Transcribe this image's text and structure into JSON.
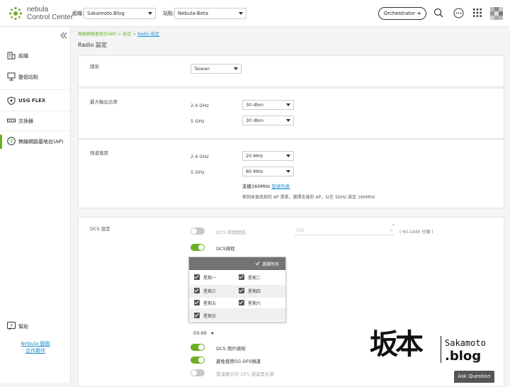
{
  "header": {
    "brand_line1": "nebula",
    "brand_line2": "Control Center",
    "org_label": "組織:",
    "org_value": "Sakamoto.Blog",
    "site_label": "站點:",
    "site_value": "Nebula-Beta",
    "orchestrator_label": "Orchestrator ➔"
  },
  "sidebar": {
    "items": [
      {
        "label": "組織"
      },
      {
        "label": "整個站點"
      },
      {
        "label": "USG FLEX"
      },
      {
        "label": "交換器"
      },
      {
        "label": "無線網路基地台(AP)"
      }
    ],
    "help": "幫助",
    "link1": "Nebula 服務",
    "link2": "合作夥伴"
  },
  "breadcrumb": {
    "part1": "無線網路基地台(AP) > 設定 > ",
    "part2": "Radio 設定"
  },
  "page_title": "Radio 設定",
  "country": {
    "label": "國家",
    "value": "Taiwan"
  },
  "power": {
    "label": "最大輸出功率",
    "band24": "2.4 GHz",
    "band24_value": "30 dbm",
    "band5": "5 GHz",
    "band5_value": "30 dbm"
  },
  "bandwidth": {
    "label": "頻道寬度",
    "band24": "2.4 GHz",
    "band24_value": "20 MHz",
    "band5": "5 GHz",
    "band5_value": "80 MHz",
    "support_text": "支援160MHz ",
    "support_link": "型號列表",
    "note": "移到本頁底部的 AP 清單，選擇支援的 AP，以在 5GHz 設定 160MHz"
  },
  "dcs": {
    "label": "DCS 設定",
    "interval_label": "DCS 時間間隔",
    "interval_value": "720",
    "interval_range": "( 60-1440 分鐘 )",
    "schedule_label": "DCS排程",
    "select_all": "選擇所有",
    "days": [
      "星期一",
      "星期二",
      "星期三",
      "星期四",
      "星期五",
      "星期六",
      "星期日"
    ],
    "time_value": "03:00",
    "client_aware": "DCS 用戶感知",
    "avoid_dfs": "避免使用5G DFS頻道",
    "dfs_blacklist": "雷達顯示的 DFS 通道黑名單"
  },
  "watermark": {
    "chinese": "坂本",
    "line1": "Sakamoto",
    "line2": ".blog"
  },
  "ask_button": "Ask Question",
  "colors": {
    "accent": "#6ab023",
    "link": "#1c8fcf"
  }
}
